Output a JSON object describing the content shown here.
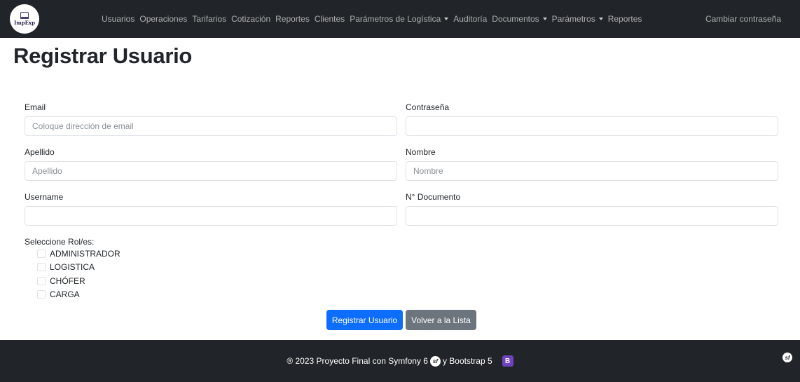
{
  "navbar": {
    "logo_text": "ImpExp",
    "links": [
      {
        "label": "Usuarios",
        "dropdown": false
      },
      {
        "label": "Operaciones",
        "dropdown": false
      },
      {
        "label": "Tarifarios",
        "dropdown": false
      },
      {
        "label": "Cotización",
        "dropdown": false
      },
      {
        "label": "Reportes",
        "dropdown": false
      },
      {
        "label": "Clientes",
        "dropdown": false
      },
      {
        "label": "Parámetros de Logística",
        "dropdown": true
      },
      {
        "label": "Auditoría",
        "dropdown": false
      },
      {
        "label": "Documentos",
        "dropdown": true
      },
      {
        "label": "Parámetros",
        "dropdown": true
      },
      {
        "label": "Reportes",
        "dropdown": false
      }
    ],
    "right_link": "Cambiar contraseña"
  },
  "page": {
    "title": "Registrar Usuario"
  },
  "form": {
    "email": {
      "label": "Email",
      "placeholder": "Coloque dirección de email",
      "value": ""
    },
    "password": {
      "label": "Contraseña",
      "placeholder": "",
      "value": ""
    },
    "lastname": {
      "label": "Apellido",
      "placeholder": "Apellido",
      "value": ""
    },
    "firstname": {
      "label": "Nombre",
      "placeholder": "Nombre",
      "value": ""
    },
    "username": {
      "label": "Username",
      "placeholder": "",
      "value": ""
    },
    "document": {
      "label": "N° Documento",
      "placeholder": "",
      "value": ""
    },
    "roles_label": "Seleccione Rol/es:",
    "roles": [
      {
        "label": "ADMINISTRADOR",
        "checked": false
      },
      {
        "label": "LOGISTICA",
        "checked": false
      },
      {
        "label": "CHÓFER",
        "checked": false
      },
      {
        "label": "CARGA",
        "checked": false
      }
    ],
    "submit_label": "Registrar Usuario",
    "back_label": "Volver a la Lista"
  },
  "footer": {
    "text_before": "® 2023 Proyecto Final con Symfony 6",
    "text_after": "y Bootstrap 5",
    "symfony_glyph": "sf",
    "bootstrap_glyph": "B"
  },
  "colors": {
    "navbar_bg": "#212529",
    "primary": "#0d6efd",
    "secondary": "#6c757d",
    "bootstrap_purple": "#6f42c1"
  }
}
